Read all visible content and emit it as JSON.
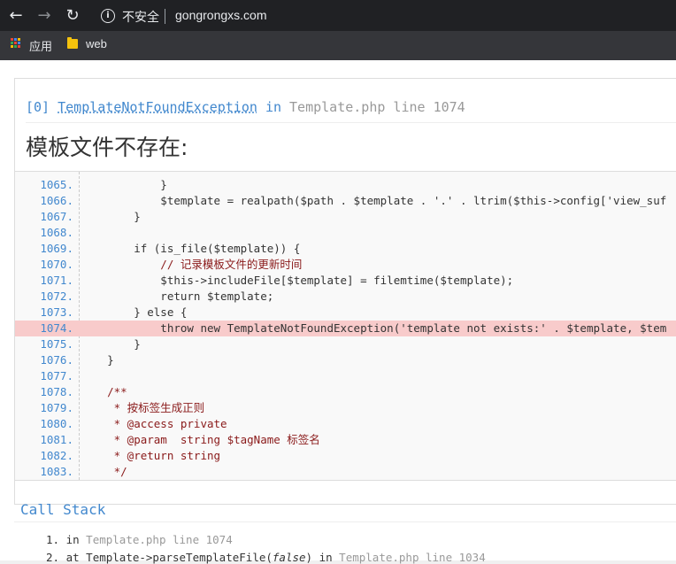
{
  "browser": {
    "security_label": "不安全",
    "url": "gongrongxs.com",
    "bookmarks": [
      {
        "label": "应用",
        "icon": "apps-grid-icon"
      },
      {
        "label": "web",
        "icon": "folder-icon"
      }
    ],
    "accent": "#202124"
  },
  "exception": {
    "index": "[0]",
    "class": "TemplateNotFoundException",
    "in_word": "in",
    "location": "Template.php line 1074",
    "message": "模板文件不存在:"
  },
  "code": {
    "highlight_line": "1074.",
    "lines": [
      {
        "n": "1065.",
        "text": "            }"
      },
      {
        "n": "1066.",
        "text": "            $template = realpath($path . $template . '.' . ltrim($this->config['view_suf"
      },
      {
        "n": "1067.",
        "text": "        }"
      },
      {
        "n": "1068.",
        "text": ""
      },
      {
        "n": "1069.",
        "text": "        if (is_file($template)) {"
      },
      {
        "n": "1070.",
        "text": "            // 记录模板文件的更新时间"
      },
      {
        "n": "1071.",
        "text": "            $this->includeFile[$template] = filemtime($template);"
      },
      {
        "n": "1072.",
        "text": "            return $template;"
      },
      {
        "n": "1073.",
        "text": "        } else {"
      },
      {
        "n": "1074.",
        "text": "            throw new TemplateNotFoundException('template not exists:' . $template, $tem"
      },
      {
        "n": "1075.",
        "text": "        }"
      },
      {
        "n": "1076.",
        "text": "    }"
      },
      {
        "n": "1077.",
        "text": ""
      },
      {
        "n": "1078.",
        "text": "    /**"
      },
      {
        "n": "1079.",
        "text": "     * 按标签生成正则"
      },
      {
        "n": "1080.",
        "text": "     * @access private"
      },
      {
        "n": "1081.",
        "text": "     * @param  string $tagName 标签名"
      },
      {
        "n": "1082.",
        "text": "     * @return string"
      },
      {
        "n": "1083.",
        "text": "     */"
      }
    ]
  },
  "call_stack": {
    "title": "Call Stack",
    "items": [
      {
        "num": "1.",
        "prefix": "in ",
        "call": "",
        "arg": "",
        "suffix": "",
        "file": "Template.php line 1074"
      },
      {
        "num": "2.",
        "prefix": "at ",
        "call": "Template->parseTemplateFile(",
        "arg": "false",
        "suffix": ") in ",
        "file": "Template.php line 1034"
      }
    ]
  }
}
